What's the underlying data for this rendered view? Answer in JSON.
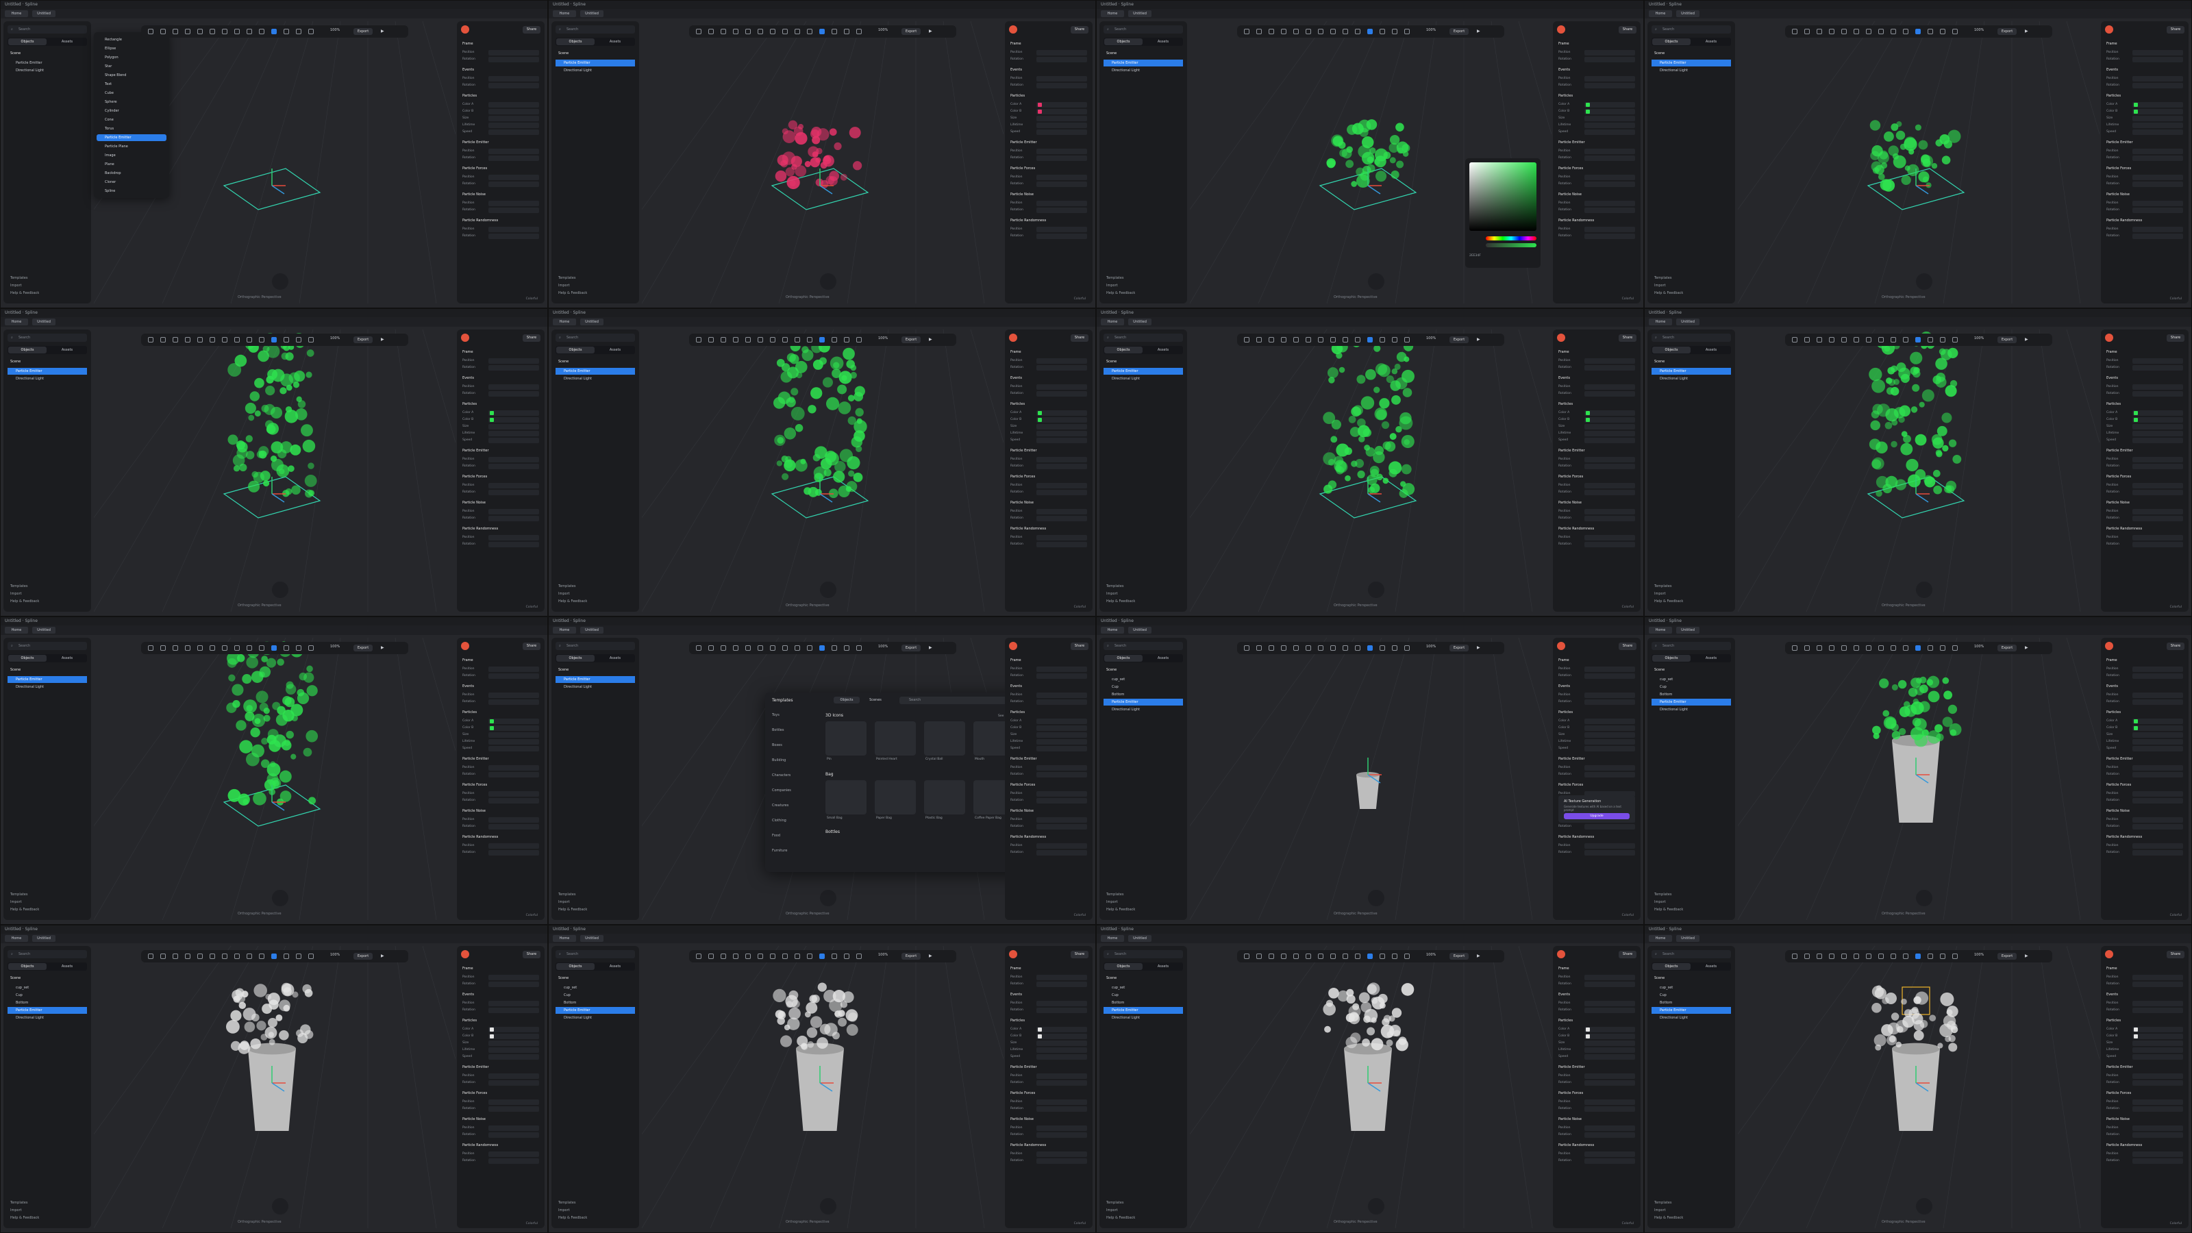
{
  "app": {
    "window_title": "Untitled · Spline",
    "tabs": [
      "Home",
      "Untitled"
    ]
  },
  "left_panel": {
    "search_placeholder": "Search",
    "tab_objects": "Objects",
    "tab_assets": "Assets",
    "scene_label": "Scene",
    "objects_default": [
      "Particle Emitter",
      "Directional Light"
    ],
    "objects_cup": [
      "cup_set",
      "Cup",
      "Bottom",
      "Particle Emitter",
      "Directional Light"
    ],
    "footer": [
      "Templates",
      "Import",
      "Help & Feedback"
    ]
  },
  "toolbar": {
    "zoom": "100%",
    "export_label": "Export",
    "play_icon": "play-icon"
  },
  "add_menu": {
    "items": [
      "Rectangle",
      "Ellipse",
      "Polygon",
      "Star",
      "Shape Blend",
      "Text",
      "Cube",
      "Sphere",
      "Cylinder",
      "Cone",
      "Torus",
      "Particle Emitter",
      "Particle Plane",
      "Image",
      "Plane",
      "Backdrop",
      "Cloner",
      "Spline"
    ],
    "selected": "Particle Emitter"
  },
  "right_panel": {
    "share_label": "Share",
    "viewport_label": "Viewport",
    "frame_label": "Frame",
    "events_label": "Events",
    "position_label": "Position",
    "rotation_label": "Rotation",
    "scale_label": "Scale",
    "particles_label": "Particles",
    "color_a_label": "Color A",
    "color_b_label": "Color B",
    "size_label": "Size",
    "lifetime_label": "Lifetime",
    "speed_label": "Speed",
    "emitter_label": "Particle Emitter",
    "forces_label": "Particle Forces",
    "noise_label": "Particle Noise",
    "randomness_label": "Particle Randomness",
    "material_label": "Material",
    "modifiers_label": "Modifiers",
    "collision_label": "Collision",
    "colour_mode": "Colorful"
  },
  "ai_texture": {
    "title": "AI Texture Generation",
    "description": "Generate textures with AI based on a text prompt",
    "button": "Upgrade"
  },
  "color_picker": {
    "hex": "2EE34F"
  },
  "library_modal": {
    "title": "Templates",
    "tab_objects": "Objects",
    "tab_scenes": "Scenes",
    "search_placeholder": "Search",
    "categories": [
      "Toys",
      "Bottles",
      "Boxes",
      "Building",
      "Characters",
      "Companies",
      "Creatures",
      "Clothing",
      "Food",
      "Furniture"
    ],
    "section_icons": "3D Icons",
    "section_bag": "Bag",
    "section_bottles": "Bottles",
    "see_all": "See all",
    "icons": [
      "Pin",
      "Pointed Heart",
      "Crystal Ball",
      "Mouth"
    ],
    "bags": [
      "Small Bag",
      "Paper Bag",
      "Plastic Bag",
      "Coffee Paper Bag"
    ]
  },
  "viewport": {
    "ortho_label": "Orthographic",
    "persp_label": "Perspective"
  },
  "frames": [
    {
      "variant": "menu",
      "particle_color": "none"
    },
    {
      "variant": "default",
      "particle_color": "#e8336a"
    },
    {
      "variant": "picker",
      "particle_color": "#2ee34f"
    },
    {
      "variant": "default",
      "particle_color": "#2ee34f"
    },
    {
      "variant": "default",
      "particle_color": "#2ee34f"
    },
    {
      "variant": "default",
      "particle_color": "#2ee34f"
    },
    {
      "variant": "default",
      "particle_color": "#2ee34f"
    },
    {
      "variant": "default",
      "particle_color": "#2ee34f"
    },
    {
      "variant": "default",
      "particle_color": "#2ee34f"
    },
    {
      "variant": "modal",
      "particle_color": "none"
    },
    {
      "variant": "cup-ai",
      "particle_color": "none"
    },
    {
      "variant": "cup",
      "particle_color": "#2ee34f"
    },
    {
      "variant": "cup",
      "particle_color": "#e5e5e5"
    },
    {
      "variant": "cup",
      "particle_color": "#e5e5e5"
    },
    {
      "variant": "cup",
      "particle_color": "#e5e5e5"
    },
    {
      "variant": "cup-box",
      "particle_color": "#e5e5e5"
    }
  ]
}
